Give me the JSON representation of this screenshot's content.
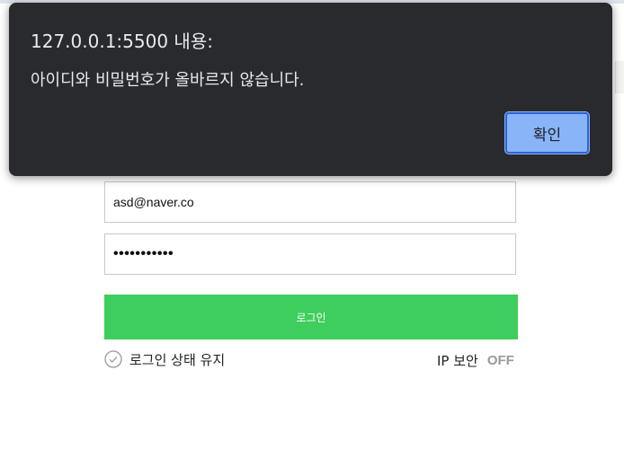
{
  "dialog": {
    "title": "127.0.0.1:5500 내용:",
    "message": "아이디와 비밀번호가 올바르지 않습니다.",
    "ok_label": "확인"
  },
  "login_form": {
    "id_value": "asd@naver.co",
    "password_value": "•••••••••••",
    "login_label": "로그인",
    "keep_login_label": "로그인 상태 유지",
    "ip_security_label": "IP 보안",
    "ip_security_state": "OFF"
  },
  "colors": {
    "dialog_bg": "#292a2d",
    "dialog_button": "#8ab4f8",
    "login_button": "#3ece5d",
    "toggle_off": "#999999"
  },
  "icons": {
    "keep_login": "check-circle-icon"
  }
}
